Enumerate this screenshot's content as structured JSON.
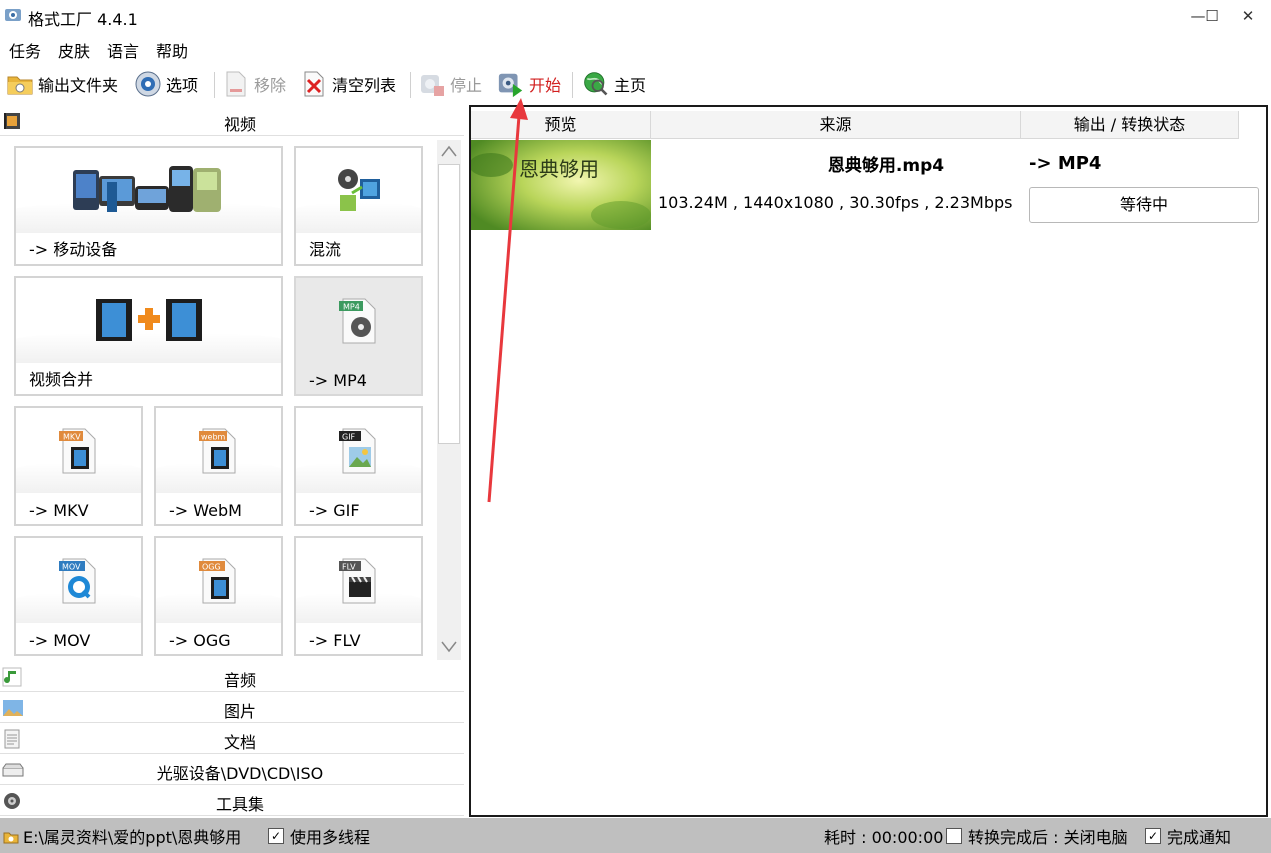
{
  "window": {
    "title": "格式工厂 4.4.1",
    "controls": {
      "minimize": "—",
      "maximize": "☐",
      "close": "✕"
    }
  },
  "menu": [
    "任务",
    "皮肤",
    "语言",
    "帮助"
  ],
  "toolbar": {
    "output_folder": "输出文件夹",
    "options": "选项",
    "remove": "移除",
    "clear_list": "清空列表",
    "stop": "停止",
    "start": "开始",
    "home": "主页"
  },
  "left": {
    "video_header": "视频",
    "tiles": {
      "mobile": "-> 移动设备",
      "mux": "混流",
      "merge": "视频合并",
      "mp4": "-> MP4",
      "mkv": "-> MKV",
      "webm": "-> WebM",
      "gif": "-> GIF",
      "mov": "-> MOV",
      "ogg": "-> OGG",
      "flv": "-> FLV"
    },
    "icon_tags": {
      "mp4": "MP4",
      "mkv": "MKV",
      "webm": "webm",
      "gif": "GIF",
      "mov": "MOV",
      "ogg": "OGG",
      "flv": "FLV"
    },
    "categories": {
      "audio": "音频",
      "image": "图片",
      "document": "文档",
      "disc": "光驱设备\\DVD\\CD\\ISO",
      "tools": "工具集"
    }
  },
  "tasklist": {
    "columns": {
      "preview": "预览",
      "source": "来源",
      "output": "输出 / 转换状态"
    },
    "row": {
      "preview_text": "恩典够用",
      "filename": "恩典够用.mp4",
      "info": "103.24M , 1440x1080 , 30.30fps , 2.23Mbps",
      "target": "-> MP4",
      "status": "等待中"
    }
  },
  "status": {
    "path": "E:\\属灵资料\\爱的ppt\\恩典够用",
    "multithread": "使用多线程",
    "elapsed": "耗时 : 00:00:00",
    "after_done": "转换完成后 : 关闭电脑",
    "notify": "完成通知",
    "multithread_checked": "✓",
    "notify_checked": "✓"
  },
  "colors": {
    "annotation": "#e8383d",
    "selected_tile": "#e9e9e9",
    "statusbar": "#bfbfbf"
  }
}
